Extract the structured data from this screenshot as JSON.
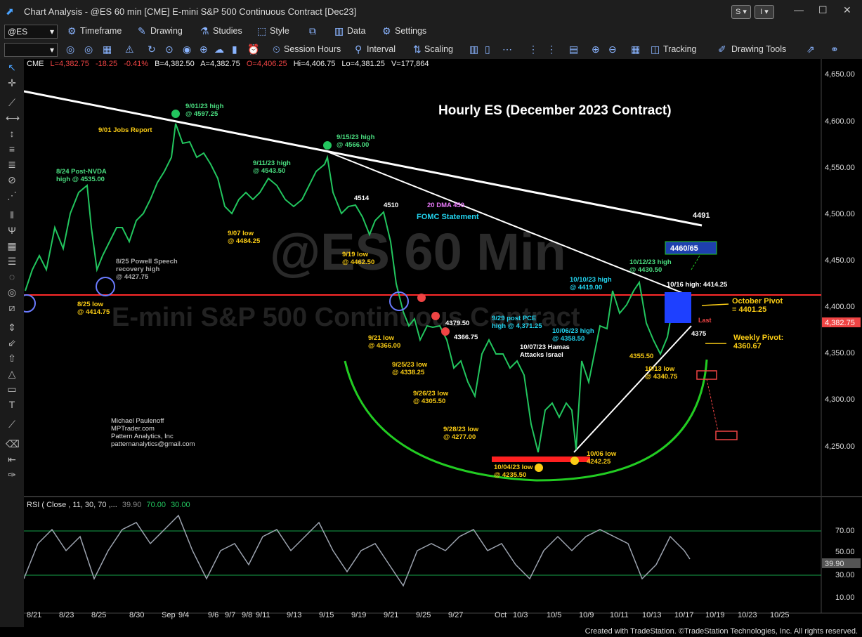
{
  "window": {
    "title": "Chart Analysis - @ES 60 min [CME] E-mini S&P 500 Continuous Contract [Dec23]",
    "btn_s": "S",
    "btn_i": "I"
  },
  "toolbar1": {
    "symbol": "@ES",
    "items": [
      "Timeframe",
      "Drawing",
      "Studies",
      "Style",
      "Data",
      "Settings"
    ]
  },
  "toolbar2": {
    "items": [
      "Session Hours",
      "Interval",
      "Scaling",
      "Tracking",
      "Drawing Tools"
    ]
  },
  "info_line": {
    "exchange": "CME",
    "last": "L=4,382.75",
    "change": "-18.25",
    "pct": "-0.41%",
    "bid": "B=4,382.50",
    "ask": "A=4,382.75",
    "open": "O=4,406.25",
    "high": "Hi=4,406.75",
    "low": "Lo=4,381.25",
    "vol": "V=177,864"
  },
  "colors": {
    "up": "#22c55e",
    "down": "#ef4444",
    "accent": "#4aa3ff",
    "pivot": "#ff2a2a",
    "arc": "#22cc22"
  },
  "chart_title": "Hourly ES (December 2023 Contract)",
  "watermark": "@ES 60 Min",
  "watermark2": "E-mini S&P 500 Continuous Contract",
  "price_axis": {
    "ticks": [
      "4,650.00",
      "4,600.00",
      "4,550.00",
      "4,500.00",
      "4,450.00",
      "4,400.00",
      "4,350.00",
      "4,300.00",
      "4,250.00"
    ],
    "last_tag": "4,382.75"
  },
  "rsi": {
    "label": "RSI ( Close , 11, 30, 70 ,...",
    "value": "39.90",
    "upper": "70.00",
    "lower": "30.00",
    "ticks": [
      "70.00",
      "50.00",
      "30.00",
      "10.00"
    ],
    "tag": "39.90"
  },
  "x_axis": [
    "8/21",
    "8/23",
    "8/25",
    "8/30",
    "Sep",
    "9/4",
    "9/6",
    "9/7",
    "9/8",
    "9/11",
    "9/13",
    "9/15",
    "9/19",
    "9/21",
    "9/25",
    "9/27",
    "Oct",
    "10/3",
    "10/5",
    "10/9",
    "10/11",
    "10/13",
    "10/17",
    "10/19",
    "10/23",
    "10/25"
  ],
  "annotations": {
    "jobs": "9/01 Jobs Report",
    "h0901": "9/01/23 high",
    "h0901v": "@ 4597.25",
    "h0915": "9/15/23 high",
    "h0915v": "@ 4566.00",
    "h0911": "9/11/23 high",
    "h0911v": "@ 4543.50",
    "h0824": "8/24 Post-NVDA",
    "h0824v": "high @ 4535.00",
    "l0907": "9/07 low",
    "l0907v": "@ 4484.25",
    "l0919": "9/19 low",
    "l0919v": "@ 4462.50",
    "p4514": "4514",
    "p4510": "4510",
    "dma": "20 DMA 450",
    "fomc": "FOMC Statement",
    "powell1": "8/25 Powell Speech",
    "powell2": "recovery high",
    "powell3": "@ 4427.75",
    "l0825": "8/25 low",
    "l0825v": "@ 4414.75",
    "l0921": "9/21 low",
    "l0921v": "@ 4366.00",
    "p4379": "4379.50",
    "p4366": "4366.75",
    "pce1": "9/29 post PCE",
    "pce2": "high @ 4,371.25",
    "l0925": "9/25/23 low",
    "l0925v": "@ 4338.25",
    "l0926": "9/26/23 low",
    "l0926v": "@ 4305.50",
    "l0928": "9/28/23 low",
    "l0928v": "@ 4277.00",
    "l1004": "10/04/23 low",
    "l1004v": "@ 4235.50",
    "l1006": "10/06 low",
    "l1006v": "4242.25",
    "hamas1": "10/07/23 Hamas",
    "hamas2": "Attacks Israel",
    "h1006": "10/06/23 high",
    "h1006v": "@ 4358.50",
    "h1010": "10/10/23 high",
    "h1010v": "@ 4419.00",
    "h1012": "10/12/23 high",
    "h1012v": "@ 4430.50",
    "h1016": "10/16 high:",
    "h1016v": "4414.25",
    "p4491": "4491",
    "target": "4460/65",
    "oct_pivot1": "October Pivot",
    "oct_pivot2": "= 4401.25",
    "weekly1": "Weekly Pivot:",
    "weekly2": "4360.67",
    "p4375": "4375",
    "p4355": "4355.50",
    "l1013": "10/13 low",
    "l1013v": "@ 4340.75",
    "last": "Last",
    "author1": "Michael Paulenoff",
    "author2": "MPTrader.com",
    "author3": "Pattern Analytics, Inc",
    "author4": "patternanalytics@gmail.com"
  },
  "status": {
    "credit": "Created with TradeStation. ©TradeStation Technologies, Inc. All rights reserved."
  }
}
